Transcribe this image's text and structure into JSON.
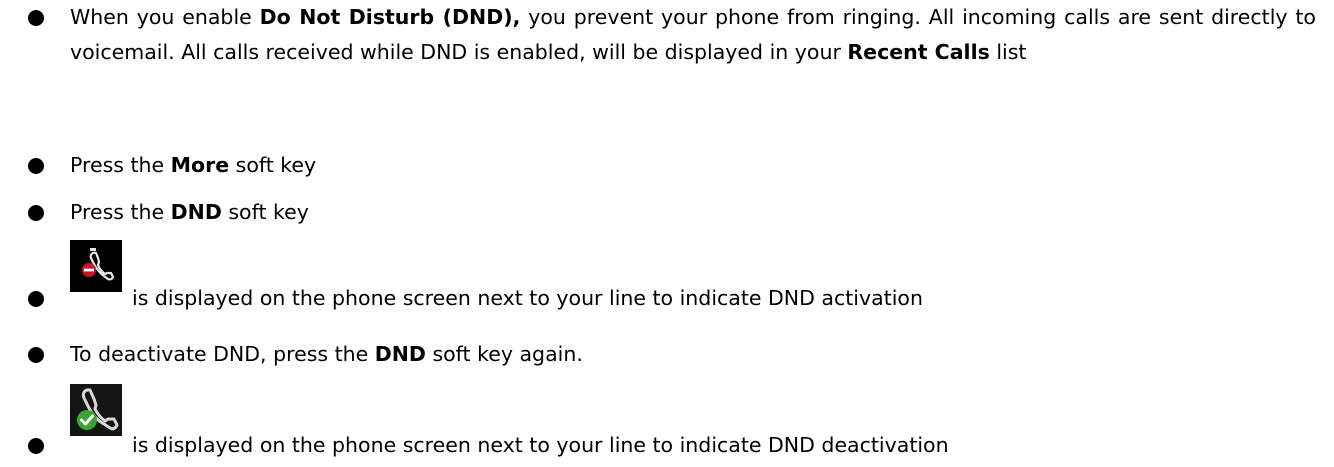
{
  "bullets": [
    {
      "parts": [
        "When you enable ",
        "Do Not Disturb (DND),",
        " you prevent your phone from ringing. All incoming calls are sent directly to voicemail. All calls received while DND is enabled, will be displayed in your ",
        "Recent Calls",
        " list"
      ]
    },
    {
      "parts": [
        "Press the ",
        "More",
        " soft key"
      ]
    },
    {
      "parts": [
        "Press the ",
        "DND",
        " soft key"
      ]
    },
    {
      "icon": "phone-dnd-active-icon",
      "text": "is displayed on the phone screen next to your line to indicate DND activation"
    },
    {
      "parts": [
        "To deactivate DND, press the ",
        "DND",
        " soft key again."
      ]
    },
    {
      "icon": "phone-dnd-inactive-icon",
      "text": "is displayed on the phone screen next to your line to indicate DND deactivation"
    }
  ],
  "colors": {
    "icon_background": "#000000",
    "dnd_active_badge": "#c0182a",
    "dnd_inactive_badge": "#3aa533",
    "handset": "#e8e8e8"
  }
}
